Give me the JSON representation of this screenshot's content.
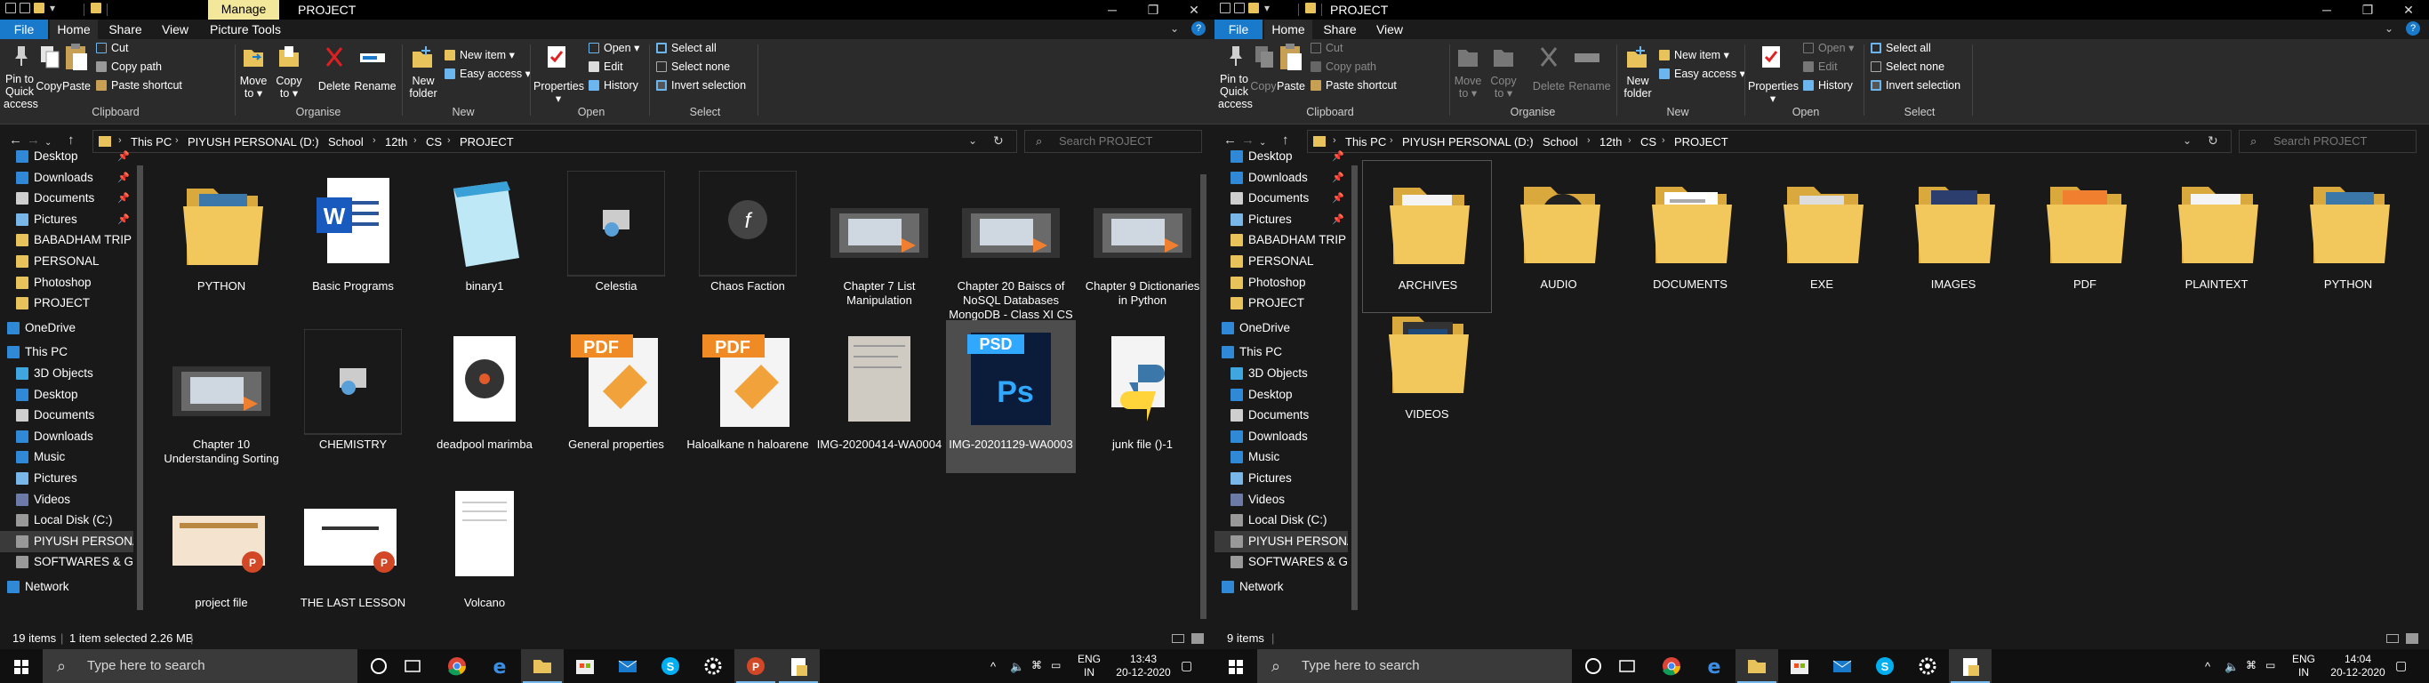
{
  "windows": [
    {
      "title": "PROJECT",
      "manage_tab": "Manage",
      "tabs": [
        "File",
        "Home",
        "Share",
        "View",
        "Picture Tools"
      ],
      "selected_tab": "Home",
      "ribbon": {
        "clipboard": {
          "pin": "Pin to Quick access",
          "copy": "Copy",
          "paste": "Paste",
          "cut": "Cut",
          "copy_path": "Copy path",
          "paste_shortcut": "Paste shortcut",
          "group": "Clipboard"
        },
        "organise": {
          "move_to": "Move to",
          "copy_to": "Copy to",
          "delete": "Delete",
          "rename": "Rename",
          "group": "Organise"
        },
        "new": {
          "new_folder": "New folder",
          "new_item": "New item",
          "easy_access": "Easy access",
          "group": "New"
        },
        "open": {
          "properties": "Properties",
          "open": "Open",
          "edit": "Edit",
          "history": "History",
          "group": "Open"
        },
        "select": {
          "select_all": "Select all",
          "select_none": "Select none",
          "invert": "Invert selection",
          "group": "Select"
        }
      },
      "breadcrumb": [
        "This PC",
        "PIYUSH PERSONAL (D:)",
        "School",
        "12th",
        "CS",
        "PROJECT"
      ],
      "search_placeholder": "Search PROJECT",
      "nav": {
        "quick": [
          "Desktop",
          "Downloads",
          "Documents",
          "Pictures",
          "BABADHAM TRIP",
          "PERSONAL",
          "Photoshop",
          "PROJECT"
        ],
        "onedrive": "OneDrive",
        "thispc": "This PC",
        "pc_items": [
          "3D Objects",
          "Desktop",
          "Documents",
          "Downloads",
          "Music",
          "Pictures",
          "Videos",
          "Local Disk (C:)",
          "PIYUSH PERSONA",
          "SOFTWARES & GA"
        ],
        "network": "Network"
      },
      "files": [
        {
          "name": "PYTHON",
          "kind": "folder-python"
        },
        {
          "name": "Basic Programs",
          "kind": "word"
        },
        {
          "name": "binary1",
          "kind": "notepad"
        },
        {
          "name": "Celestia",
          "kind": "app"
        },
        {
          "name": "Chaos Faction",
          "kind": "flash"
        },
        {
          "name": "Chapter  7 List Manipulation",
          "kind": "video"
        },
        {
          "name": "Chapter  20 Baiscs  of NoSQL Databases MongoDB - Class XI CS",
          "kind": "video"
        },
        {
          "name": "Chapter 9 Dictionaries in Python",
          "kind": "video"
        },
        {
          "name": "Chapter 10 Understanding Sorting",
          "kind": "video"
        },
        {
          "name": "CHEMISTRY",
          "kind": "app"
        },
        {
          "name": "deadpool marimba",
          "kind": "audio"
        },
        {
          "name": "General properties",
          "kind": "pdf"
        },
        {
          "name": "Haloalkane n haloarene",
          "kind": "pdf"
        },
        {
          "name": "IMG-20200414-WA0004",
          "kind": "photo"
        },
        {
          "name": "IMG-20201129-WA0003",
          "kind": "psd"
        },
        {
          "name": "junk file ()-1",
          "kind": "python"
        },
        {
          "name": "project file",
          "kind": "ppt"
        },
        {
          "name": "THE LAST LESSON",
          "kind": "ppt-white"
        },
        {
          "name": "Volcano",
          "kind": "doc"
        }
      ],
      "status": {
        "count": "19 items",
        "selected": "1 item selected  2.26 MB"
      },
      "clock": {
        "lang": "ENG",
        "region": "IN",
        "time": "13:43",
        "date": "20-12-2020"
      }
    },
    {
      "title": "PROJECT",
      "tabs": [
        "File",
        "Home",
        "Share",
        "View"
      ],
      "selected_tab": "Home",
      "breadcrumb": [
        "This PC",
        "PIYUSH PERSONAL (D:)",
        "School",
        "12th",
        "CS",
        "PROJECT"
      ],
      "search_placeholder": "Search PROJECT",
      "files": [
        {
          "name": "ARCHIVES",
          "kind": "folder"
        },
        {
          "name": "AUDIO",
          "kind": "folder-audio"
        },
        {
          "name": "DOCUMENTS",
          "kind": "folder-doc"
        },
        {
          "name": "EXE",
          "kind": "folder-exe"
        },
        {
          "name": "IMAGES",
          "kind": "folder-img"
        },
        {
          "name": "PDF",
          "kind": "folder-pdf"
        },
        {
          "name": "PLAINTEXT",
          "kind": "folder"
        },
        {
          "name": "PYTHON",
          "kind": "folder-python"
        },
        {
          "name": "VIDEOS",
          "kind": "folder-video"
        }
      ],
      "status": {
        "count": "9 items"
      },
      "clock": {
        "lang": "ENG",
        "region": "IN",
        "time": "14:04",
        "date": "20-12-2020"
      }
    }
  ],
  "taskbar": {
    "search_placeholder": "Type here to search"
  }
}
